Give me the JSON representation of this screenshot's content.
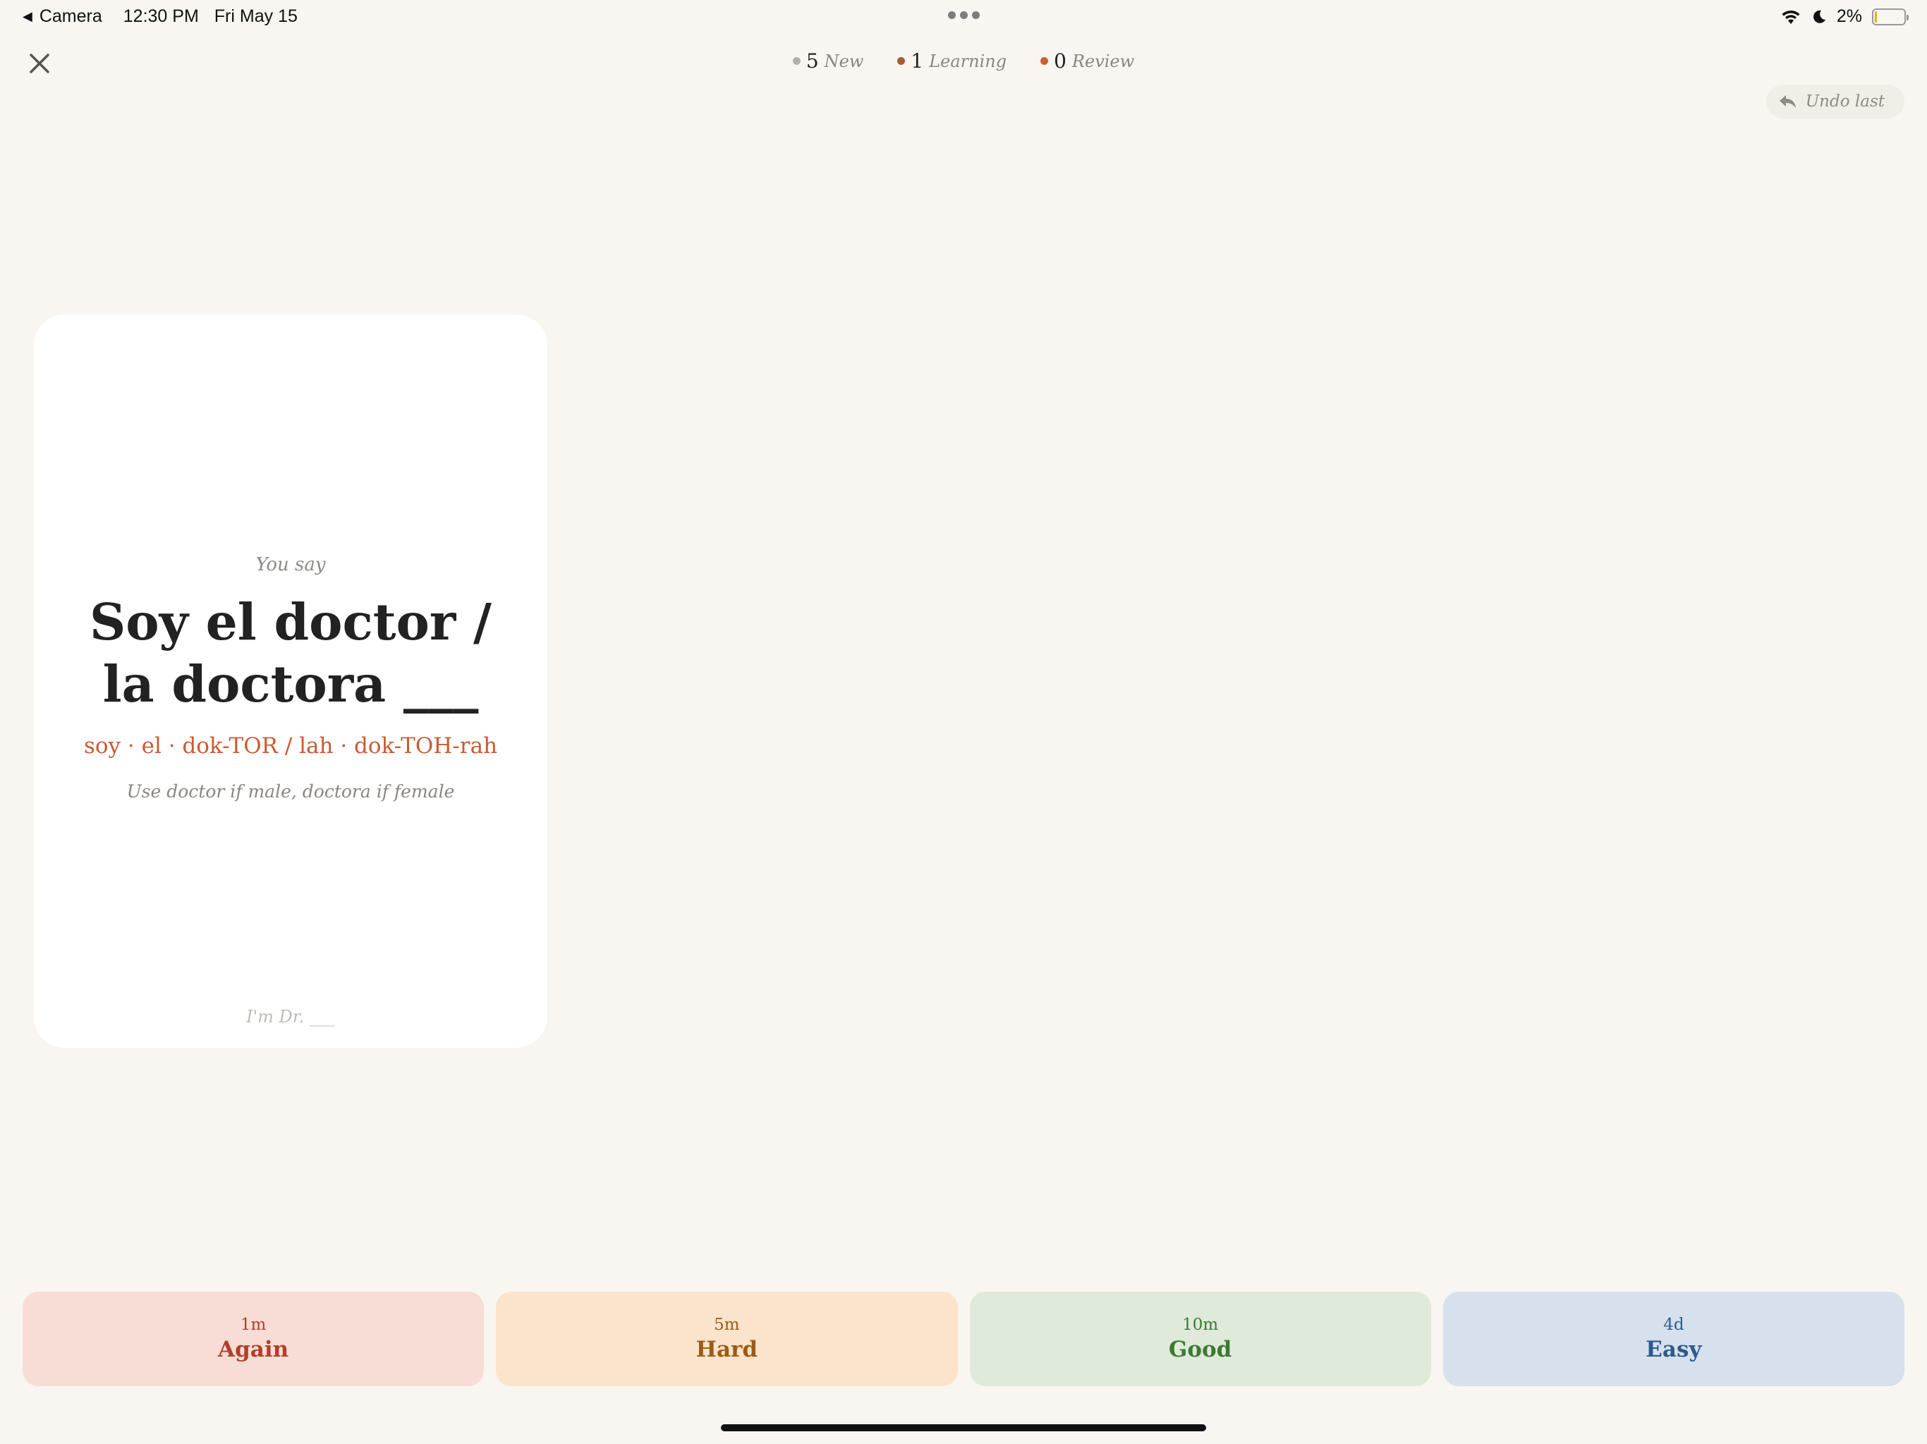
{
  "status_bar": {
    "back_label": "Camera",
    "time": "12:30 PM",
    "date": "Fri May 15",
    "battery": "2%",
    "icons": [
      "wifi-icon",
      "moon-icon",
      "battery-icon"
    ]
  },
  "header": {
    "counts": [
      {
        "value": "5",
        "label": "New",
        "color": "#b3b0ab"
      },
      {
        "value": "1",
        "label": "Learning",
        "color": "#a85d2a"
      },
      {
        "value": "0",
        "label": "Review",
        "color": "#cf5f33"
      }
    ],
    "undo_label": "Undo last"
  },
  "card": {
    "prompt_label": "You say",
    "phrase": "Soy el doctor / la doctora ___",
    "pronunciation": "soy · el · dok-TOR / lah · dok-TOH-rah",
    "note": "Use doctor if male, doctora if female",
    "translation": "I'm Dr. ___"
  },
  "answers": [
    {
      "interval": "1m",
      "label": "Again"
    },
    {
      "interval": "5m",
      "label": "Hard"
    },
    {
      "interval": "10m",
      "label": "Good"
    },
    {
      "interval": "4d",
      "label": "Easy"
    }
  ],
  "colors": {
    "background": "#f9f6f1",
    "accent": "#c95b32",
    "again": "#f8ddd6",
    "hard": "#fbe4cb",
    "good": "#dfeadb",
    "easy": "#d6e1ed"
  }
}
